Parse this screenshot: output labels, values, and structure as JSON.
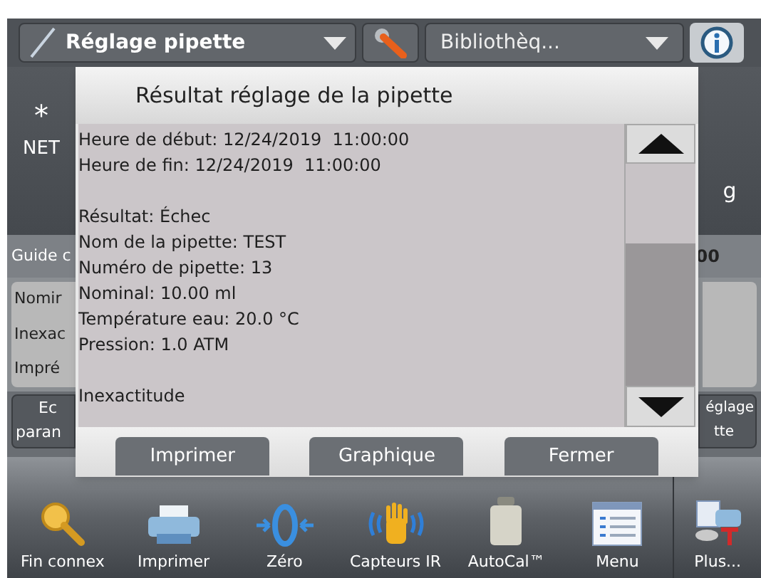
{
  "header": {
    "mode": "Réglage pipette",
    "library": "Bibliothèq..."
  },
  "background": {
    "tare_mark": "*",
    "net_label": "NET",
    "unit": "g",
    "guide": "Guide c",
    "guide_value": "00",
    "fields": [
      "Nomir",
      "Inexac",
      "Impré"
    ],
    "left_button": [
      "Ec",
      "paran"
    ],
    "right_button": [
      "églage",
      "tte"
    ]
  },
  "dialog": {
    "title": "Résultat réglage de la pipette",
    "sections": [
      [
        "Heure de début: 12/24/2019  11:00:00",
        "Heure de fin: 12/24/2019  11:00:00"
      ],
      [
        "Résultat: Échec",
        "Nom de la pipette: TEST",
        "Numéro de pipette: 13",
        "Nominal: 10.00 ml",
        "Température eau: 20.0 °C",
        "Pression: 1.0 ATM"
      ],
      [
        "Inexactitude"
      ]
    ],
    "buttons": [
      "Imprimer",
      "Graphique",
      "Fermer"
    ]
  },
  "taskbar": [
    {
      "label": "Fin connex",
      "kind": "key"
    },
    {
      "label": "Imprimer",
      "kind": "printer"
    },
    {
      "label": "Zéro",
      "kind": "zero"
    },
    {
      "label": "Capteurs IR",
      "kind": "hand"
    },
    {
      "label": "AutoCal™",
      "kind": "weight"
    },
    {
      "label": "Menu",
      "kind": "menu"
    },
    {
      "label": "Plus...",
      "kind": "more"
    }
  ]
}
